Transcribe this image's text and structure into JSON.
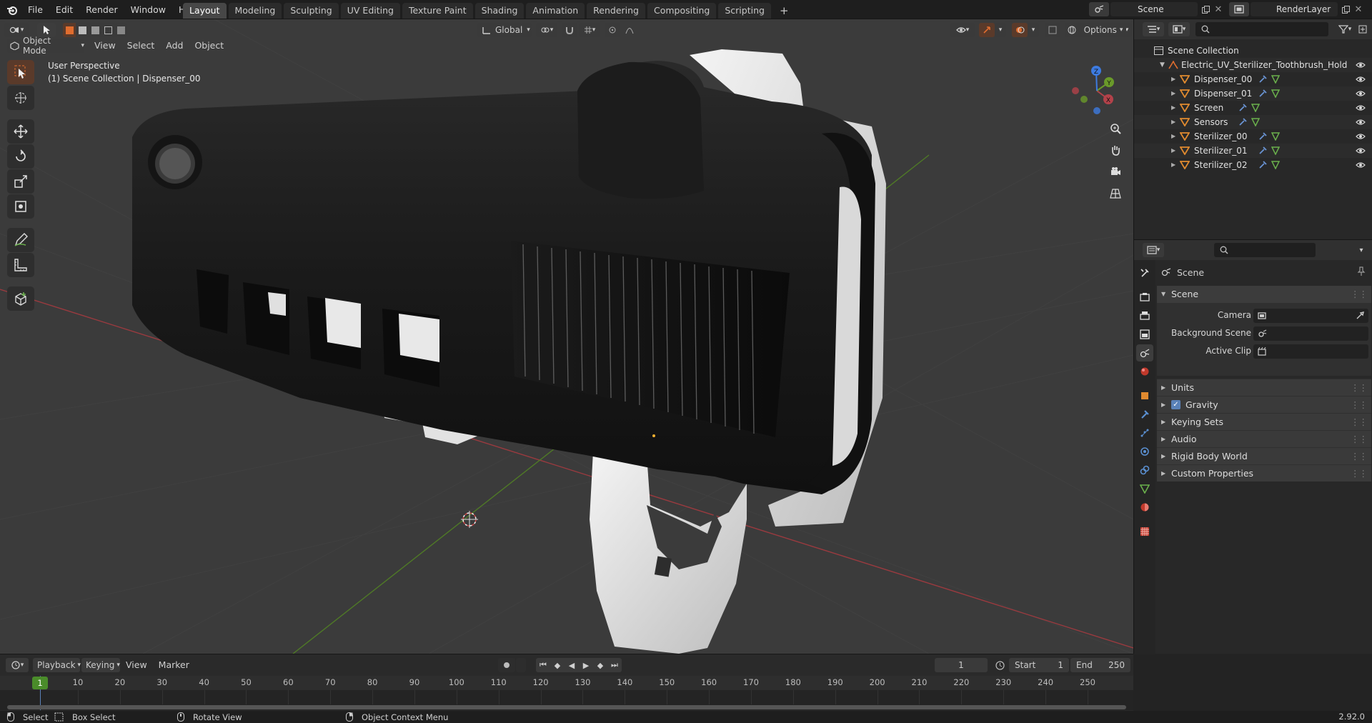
{
  "menu": {
    "file": "File",
    "edit": "Edit",
    "render": "Render",
    "window": "Window",
    "help": "Help"
  },
  "workspaces": [
    "Layout",
    "Modeling",
    "Sculpting",
    "UV Editing",
    "Texture Paint",
    "Shading",
    "Animation",
    "Rendering",
    "Compositing",
    "Scripting"
  ],
  "workspace_active": "Layout",
  "add_tab": "+",
  "scene_field": "Scene",
  "renderlayer_field": "RenderLayer",
  "viewport_header": {
    "mode": "Object Mode",
    "menus": [
      "View",
      "Select",
      "Add",
      "Object"
    ],
    "transform": "Global",
    "options": "Options"
  },
  "overlay_text": {
    "line1": "User Perspective",
    "line2": "(1) Scene Collection | Dispenser_00"
  },
  "gizmo": {
    "x": "X",
    "y": "Y",
    "z": "Z"
  },
  "outliner": {
    "root": "Scene Collection",
    "collection": "Electric_UV_Sterilizer_Toothbrush_Holder_Bl",
    "items": [
      "Dispenser_00",
      "Dispenser_01",
      "Screen",
      "Sensors",
      "Sterilizer_00",
      "Sterilizer_01",
      "Sterilizer_02"
    ]
  },
  "properties": {
    "header": "Scene",
    "panel_title": "Scene",
    "fields": {
      "camera": "Camera",
      "background_scene": "Background Scene",
      "active_clip": "Active Clip"
    },
    "subpanels": [
      "Units",
      "Gravity",
      "Keying Sets",
      "Audio",
      "Rigid Body World",
      "Custom Properties"
    ],
    "gravity_checked": true
  },
  "timeline": {
    "menus": {
      "playback": "Playback",
      "keying": "Keying",
      "view": "View",
      "marker": "Marker"
    },
    "current_frame": "1",
    "start_label": "Start",
    "start": "1",
    "end_label": "End",
    "end": "250",
    "ruler": [
      "1",
      "10",
      "20",
      "30",
      "40",
      "50",
      "60",
      "70",
      "80",
      "90",
      "100",
      "110",
      "120",
      "130",
      "140",
      "150",
      "160",
      "170",
      "180",
      "190",
      "200",
      "210",
      "220",
      "230",
      "240",
      "250"
    ]
  },
  "statusbar": {
    "select": "Select",
    "box_select": "Box Select",
    "rotate_view": "Rotate View",
    "context_menu": "Object Context Menu",
    "version": "2.92.0"
  },
  "colors": {
    "accent": "#e06d2f",
    "blue": "#5a82b8",
    "x_axis": "#b3424a",
    "y_axis": "#6a9a2a",
    "z_axis": "#3d7be0"
  }
}
